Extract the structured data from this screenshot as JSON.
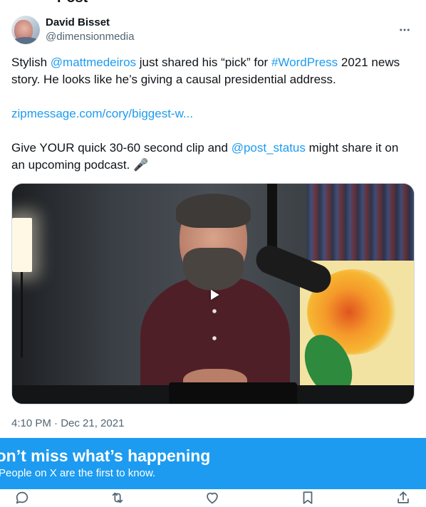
{
  "header_partial_title": "Post",
  "author": {
    "display_name": "David Bisset",
    "handle": "@dimensionmedia"
  },
  "tweet": {
    "p1_before": "Stylish ",
    "p1_mention": "@mattmedeiros",
    "p1_mid": " just shared his “pick” for ",
    "p1_hashtag": "#WordPress",
    "p1_after": " 2021 news story. He looks like he’s giving a causal presidential address.",
    "link": "zipmessage.com/cory/biggest-w...",
    "p3_before": "Give YOUR quick 30-60 second clip and ",
    "p3_mention": "@post_status",
    "p3_after": " might share it on an upcoming podcast. 🎤"
  },
  "timestamp": "4:10 PM · Dec 21, 2021",
  "banner": {
    "title": "Don’t miss what’s happening",
    "subtitle": "People on X are the first to know."
  },
  "icons": {
    "more": "more-horizontal-icon",
    "play": "play-icon",
    "reply": "reply-icon",
    "retweet": "retweet-icon",
    "like": "heart-icon",
    "bookmark": "bookmark-icon",
    "share": "share-icon"
  },
  "colors": {
    "link": "#1d9bf0",
    "banner": "#1d9bf0",
    "secondary_text": "#536471"
  }
}
